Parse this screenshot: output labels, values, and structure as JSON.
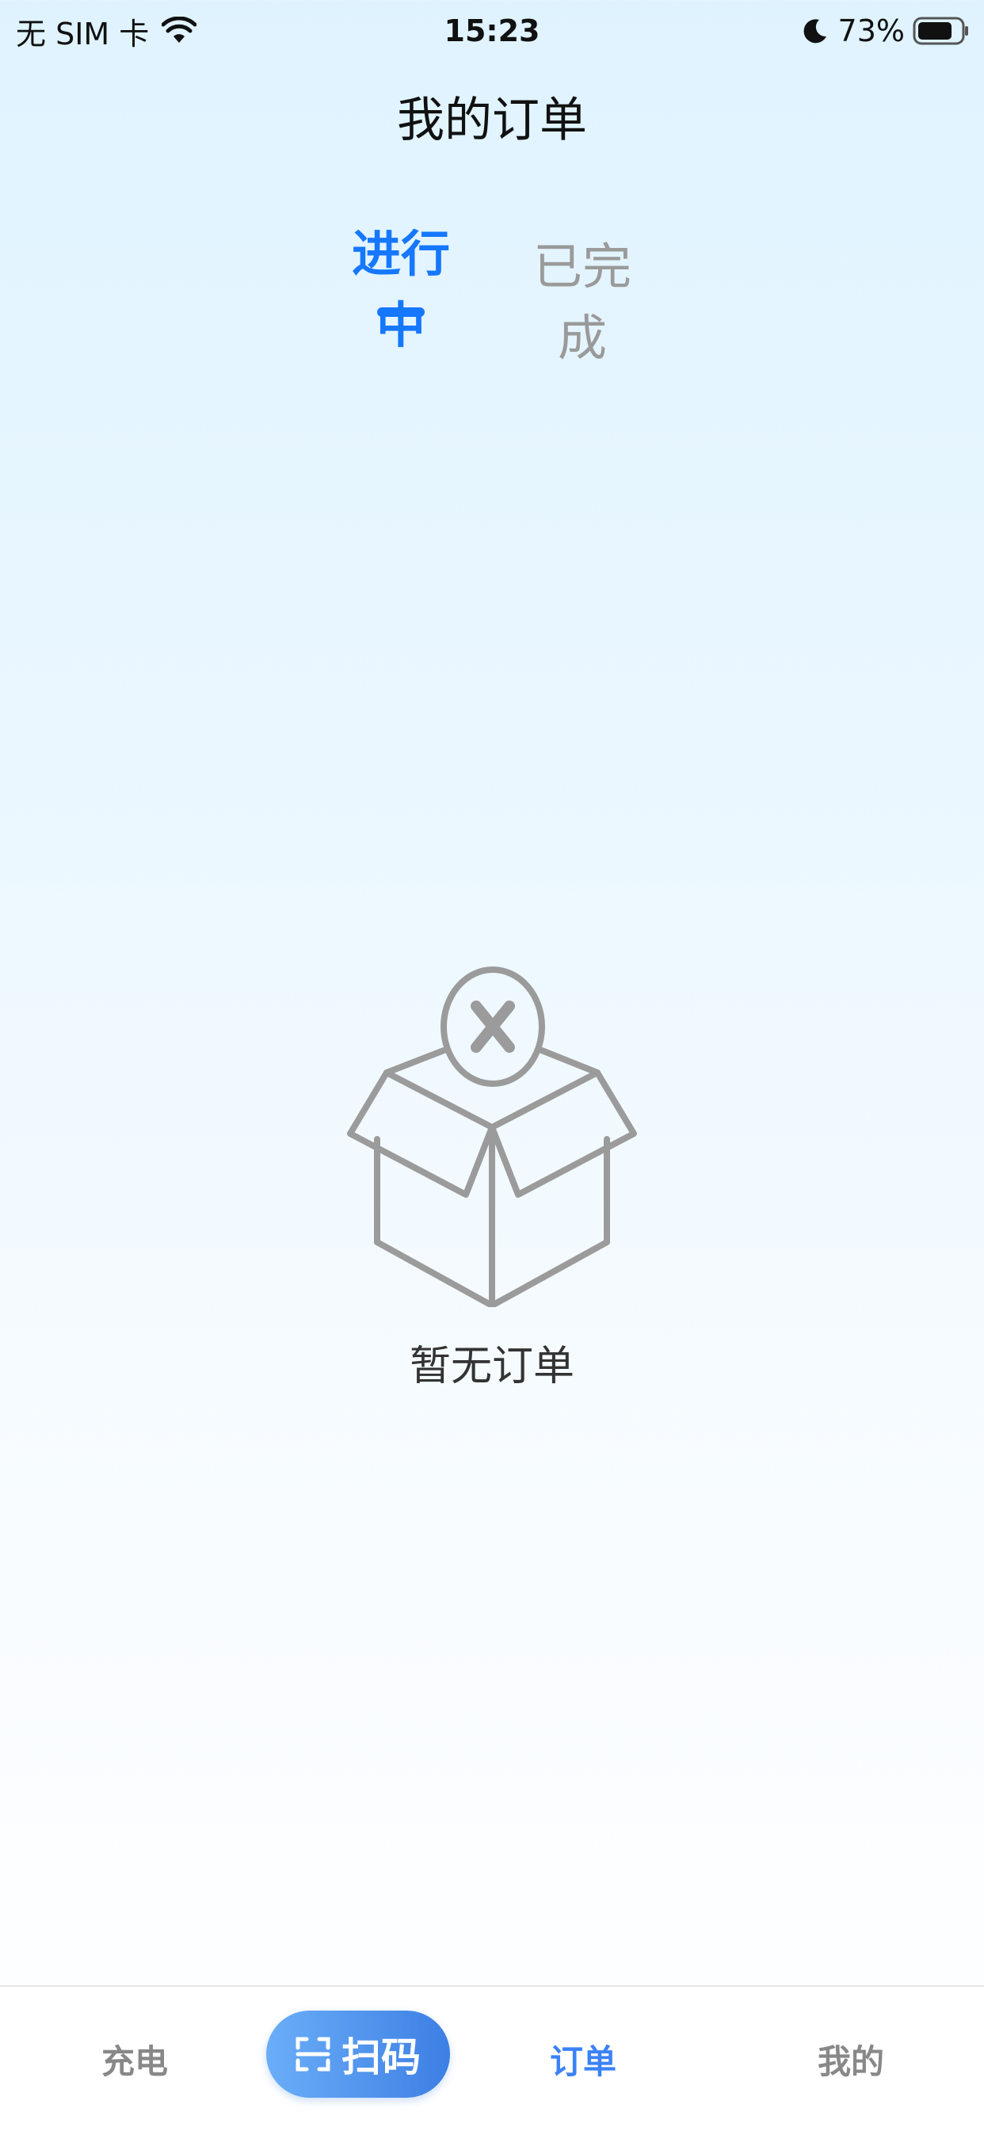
{
  "status_bar": {
    "carrier": "无 SIM 卡",
    "time": "15:23",
    "battery_percent": "73%"
  },
  "header": {
    "title": "我的订单"
  },
  "tabs": [
    {
      "label": "进行中",
      "active": true
    },
    {
      "label": "已完成",
      "active": false
    }
  ],
  "empty_state": {
    "icon": "empty-box-icon",
    "message": "暂无订单"
  },
  "bottom_nav": {
    "items": [
      {
        "label": "充电",
        "icon": "charge",
        "active": false
      },
      {
        "label": "扫码",
        "icon": "scan-icon",
        "active": false
      },
      {
        "label": "订单",
        "icon": "orders",
        "active": true
      },
      {
        "label": "我的",
        "icon": "profile",
        "active": false
      }
    ]
  },
  "colors": {
    "accent": "#1677ff",
    "inactive_tab": "#9a9a9a",
    "scan_button_start": "#6aaef8",
    "scan_button_end": "#3d7fe4",
    "icon_gray": "#999999"
  }
}
